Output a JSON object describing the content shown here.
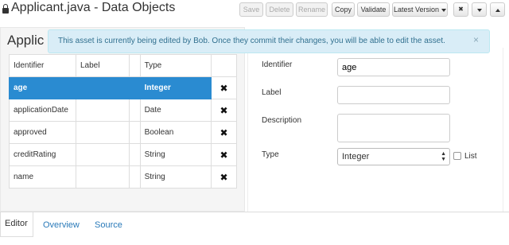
{
  "window": {
    "title": "Applicant.java - Data Objects"
  },
  "toolbar": {
    "save": "Save",
    "delete": "Delete",
    "rename": "Rename",
    "copy": "Copy",
    "validate": "Validate",
    "latest_version": "Latest Version",
    "close": "✖"
  },
  "alert": {
    "message": "This asset is currently being edited by Bob. Once they commit their changes, you will be able to edit the asset.",
    "close": "×"
  },
  "left_panel": {
    "title": "Applic",
    "columns": [
      "Identifier",
      "Label",
      "",
      "Type",
      ""
    ],
    "rows": [
      {
        "identifier": "age",
        "label": "",
        "type": "Integer",
        "selected": true
      },
      {
        "identifier": "applicationDate",
        "label": "",
        "type": "Date",
        "selected": false
      },
      {
        "identifier": "approved",
        "label": "",
        "type": "Boolean",
        "selected": false
      },
      {
        "identifier": "creditRating",
        "label": "",
        "type": "String",
        "selected": false
      },
      {
        "identifier": "name",
        "label": "",
        "type": "String",
        "selected": false
      }
    ],
    "delete_glyph": "✖"
  },
  "form": {
    "identifier_label": "Identifier",
    "identifier_value": "age",
    "label_label": "Label",
    "label_value": "",
    "description_label": "Description",
    "description_value": "",
    "type_label": "Type",
    "type_value": "Integer",
    "list_label": "List",
    "list_checked": false
  },
  "tabs": {
    "editor": "Editor",
    "overview": "Overview",
    "source": "Source"
  }
}
